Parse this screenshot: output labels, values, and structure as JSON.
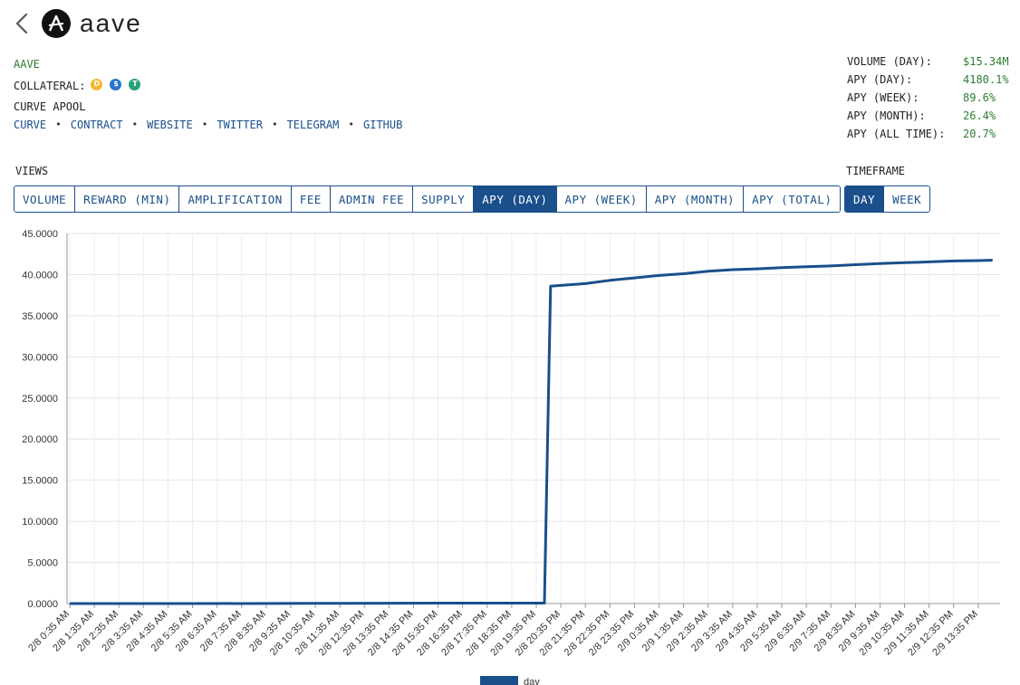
{
  "header": {
    "title": "aave",
    "back_icon": "chevron-left-icon",
    "logo_icon": "aave-logo-icon"
  },
  "pool": {
    "name": "AAVE",
    "collateral_label": "COLLATERAL:",
    "collateral_icons": [
      {
        "name": "dai-icon",
        "color": "#f4b731",
        "glyph": "D"
      },
      {
        "name": "usdc-icon",
        "color": "#2775ca",
        "glyph": "$"
      },
      {
        "name": "usdt-icon",
        "color": "#26a17b",
        "glyph": "T"
      }
    ],
    "subtitle": "CURVE APOOL",
    "links": [
      "CURVE",
      "CONTRACT",
      "WEBSITE",
      "TWITTER",
      "TELEGRAM",
      "GITHUB"
    ]
  },
  "stats": [
    {
      "label": "VOLUME (DAY):",
      "value": "$15.34M"
    },
    {
      "label": "APY (DAY):",
      "value": "4180.1%"
    },
    {
      "label": "APY (WEEK):",
      "value": "89.6%"
    },
    {
      "label": "APY (MONTH):",
      "value": "26.4%"
    },
    {
      "label": "APY (ALL TIME):",
      "value": "20.7%"
    }
  ],
  "views": {
    "label": "VIEWS",
    "options": [
      "VOLUME",
      "REWARD (MIN)",
      "AMPLIFICATION",
      "FEE",
      "ADMIN FEE",
      "SUPPLY",
      "APY (DAY)",
      "APY (WEEK)",
      "APY (MONTH)",
      "APY (TOTAL)"
    ],
    "active": "APY (DAY)"
  },
  "timeframe": {
    "label": "TIMEFRAME",
    "options": [
      "DAY",
      "WEEK"
    ],
    "active": "DAY"
  },
  "colors": {
    "accent": "#1a4f8b",
    "positive": "#2e7d32"
  },
  "chart_data": {
    "type": "line",
    "ylim": [
      0,
      45
    ],
    "y_ticks": [
      "0.0000",
      "5.0000",
      "10.0000",
      "15.0000",
      "20.0000",
      "25.0000",
      "30.0000",
      "35.0000",
      "40.0000",
      "45.0000"
    ],
    "x_tick_labels": [
      "2/8 0:35 AM",
      "2/8 1:35 AM",
      "2/8 2:35 AM",
      "2/8 3:35 AM",
      "2/8 4:35 AM",
      "2/8 5:35 AM",
      "2/8 6:35 AM",
      "2/8 7:35 AM",
      "2/8 8:35 AM",
      "2/8 9:35 AM",
      "2/8 10:35 AM",
      "2/8 11:35 AM",
      "2/8 12:35 PM",
      "2/8 13:35 PM",
      "2/8 14:35 PM",
      "2/8 15:35 PM",
      "2/8 16:35 PM",
      "2/8 17:35 PM",
      "2/8 18:35 PM",
      "2/8 19:35 PM",
      "2/8 20:35 PM",
      "2/8 21:35 PM",
      "2/8 22:35 PM",
      "2/8 23:35 PM",
      "2/9 0:35 AM",
      "2/9 1:35 AM",
      "2/9 2:35 AM",
      "2/9 3:35 AM",
      "2/9 4:35 AM",
      "2/9 5:35 AM",
      "2/9 6:35 AM",
      "2/9 7:35 AM",
      "2/9 8:35 AM",
      "2/9 9:35 AM",
      "2/9 10:35 AM",
      "2/9 11:35 AM",
      "2/9 12:35 PM",
      "2/9 13:35 PM"
    ],
    "grid": true,
    "legend": "bottom",
    "series": [
      {
        "name": "day",
        "color": "#1a4f8b",
        "points": [
          [
            "2/8 0:35 AM",
            0.0
          ],
          [
            "2/8 5:35 AM",
            0.0
          ],
          [
            "2/8 10:35 AM",
            0.02
          ],
          [
            "2/8 15:35 PM",
            0.05
          ],
          [
            "2/8 19:35 PM",
            0.05
          ],
          [
            "2/8 19:55 PM",
            0.05
          ],
          [
            "2/8 20:10 PM",
            38.6
          ],
          [
            "2/8 21:35 PM",
            38.9
          ],
          [
            "2/8 22:35 PM",
            39.3
          ],
          [
            "2/8 23:35 PM",
            39.6
          ],
          [
            "2/9 0:35 AM",
            39.9
          ],
          [
            "2/9 1:35 AM",
            40.1
          ],
          [
            "2/9 2:35 AM",
            40.4
          ],
          [
            "2/9 3:35 AM",
            40.6
          ],
          [
            "2/9 4:35 AM",
            40.7
          ],
          [
            "2/9 5:35 AM",
            40.85
          ],
          [
            "2/9 6:35 AM",
            40.95
          ],
          [
            "2/9 7:35 AM",
            41.05
          ],
          [
            "2/9 8:35 AM",
            41.2
          ],
          [
            "2/9 9:35 AM",
            41.35
          ],
          [
            "2/9 10:35 AM",
            41.45
          ],
          [
            "2/9 11:35 AM",
            41.55
          ],
          [
            "2/9 12:35 PM",
            41.65
          ],
          [
            "2/9 13:35 PM",
            41.7
          ],
          [
            "2/9 14:10 PM",
            41.75
          ]
        ]
      }
    ]
  }
}
